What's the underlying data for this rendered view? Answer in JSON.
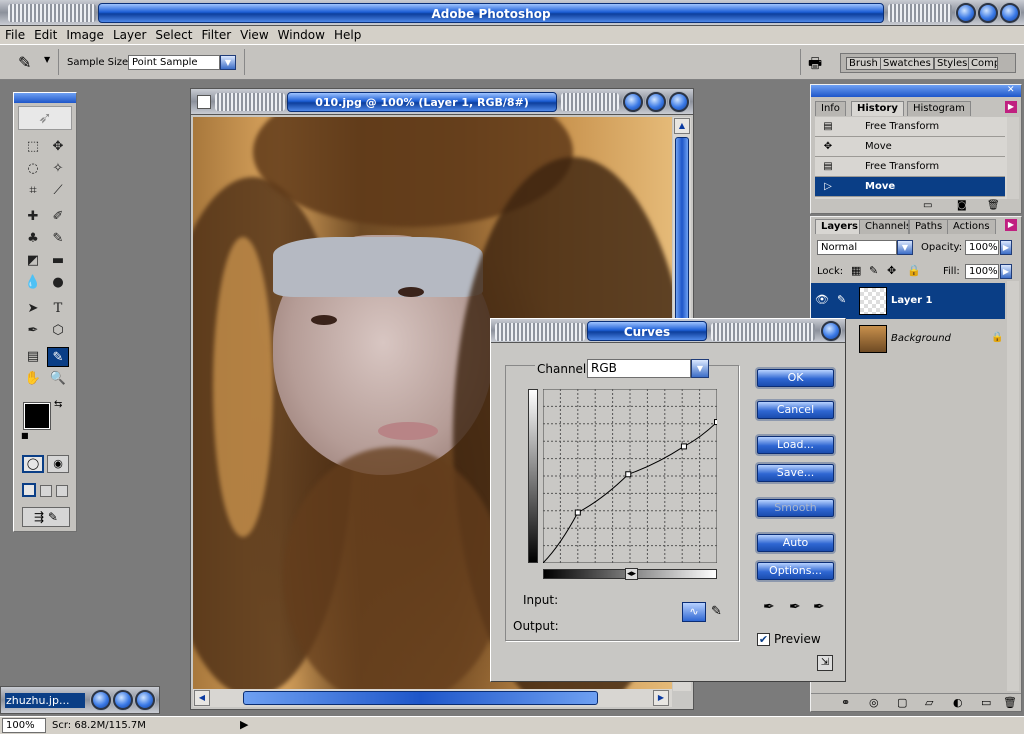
{
  "app": {
    "title": "Adobe Photoshop"
  },
  "menu": [
    "File",
    "Edit",
    "Image",
    "Layer",
    "Select",
    "Filter",
    "View",
    "Window",
    "Help"
  ],
  "options_bar": {
    "sample_label": "Sample Size:",
    "sample_value": "Point Sample"
  },
  "palette_well": [
    "Brush",
    "Swatches",
    "Styles",
    "Comps"
  ],
  "document": {
    "title": "010.jpg @ 100% (Layer 1, RGB/8#)"
  },
  "minimized_doc": {
    "title": "zhuzhu.jp..."
  },
  "history_panel": {
    "tabs": [
      "Info",
      "History",
      "Histogram"
    ],
    "items": [
      {
        "label": "Free Transform",
        "icon": "transform-icon"
      },
      {
        "label": "Move",
        "icon": "move-icon"
      },
      {
        "label": "Free Transform",
        "icon": "transform-icon"
      },
      {
        "label": "Move",
        "icon": "move-icon",
        "selected": true
      }
    ]
  },
  "layers_panel": {
    "tabs": [
      "Layers",
      "Channels",
      "Paths",
      "Actions"
    ],
    "blend_mode": "Normal",
    "opacity_label": "Opacity:",
    "opacity_value": "100%",
    "lock_label": "Lock:",
    "fill_label": "Fill:",
    "fill_value": "100%",
    "layers": [
      {
        "name": "Layer 1",
        "selected": true
      },
      {
        "name": "Background",
        "locked": true
      }
    ]
  },
  "curves": {
    "title": "Curves",
    "channel_label": "Channel:",
    "channel_value": "RGB",
    "buttons": [
      "OK",
      "Cancel",
      "Load...",
      "Save...",
      "Smooth",
      "Auto",
      "Options..."
    ],
    "input_label": "Input:",
    "output_label": "Output:",
    "preview_label": "Preview",
    "preview_checked": true,
    "curve_points": [
      [
        0,
        0
      ],
      [
        0.2,
        0.29
      ],
      [
        0.49,
        0.51
      ],
      [
        0.81,
        0.67
      ],
      [
        1,
        0.81
      ]
    ]
  },
  "status": {
    "zoom": "100%",
    "scratch": "Scr: 68.2M/115.7M"
  },
  "colors": {
    "accent": "#1d5fd6",
    "selection": "#0a3e86",
    "panel": "#c4c2be"
  }
}
